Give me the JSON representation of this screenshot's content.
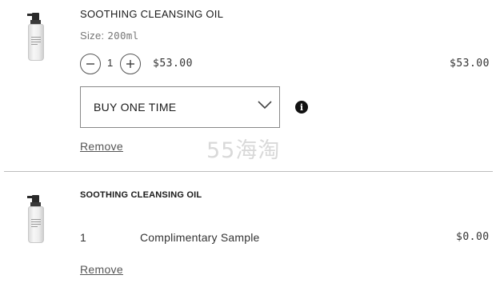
{
  "items": [
    {
      "name": "SOOTHING CLEANSING OIL",
      "size_label": "Size:",
      "size_value": "200ml",
      "quantity": "1",
      "unit_price": "$53.00",
      "line_total": "$53.00",
      "purchase_option": "BUY ONE TIME",
      "remove_label": "Remove"
    },
    {
      "name": "SOOTHING CLEANSING OIL",
      "quantity": "1",
      "description": "Complimentary Sample",
      "line_total": "$0.00",
      "remove_label": "Remove"
    }
  ],
  "watermark": "55海淘",
  "icons": {
    "decrease": "minus-icon",
    "increase": "plus-icon",
    "dropdown": "chevron-down-icon",
    "info": "info-icon"
  }
}
